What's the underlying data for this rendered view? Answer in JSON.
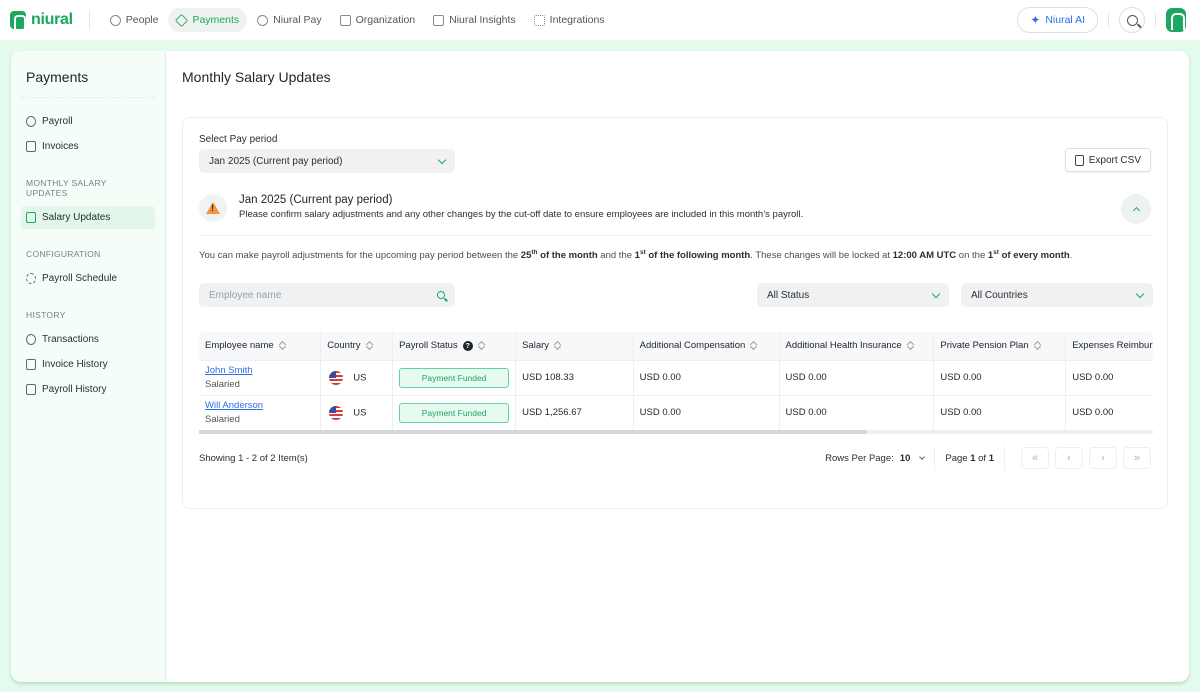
{
  "brand": {
    "name": "niural",
    "color": "#1ca860"
  },
  "nav": {
    "items": [
      {
        "label": "People",
        "icon": "people-icon",
        "active": false
      },
      {
        "label": "Payments",
        "icon": "payments-icon",
        "active": true
      },
      {
        "label": "Niural Pay",
        "icon": "shield-icon",
        "active": false
      },
      {
        "label": "Organization",
        "icon": "building-icon",
        "active": false
      },
      {
        "label": "Niural Insights",
        "icon": "chart-icon",
        "active": false
      },
      {
        "label": "Integrations",
        "icon": "grid-icon",
        "active": false
      }
    ],
    "ai_button": "Niural AI"
  },
  "sidebar": {
    "title": "Payments",
    "groups": [
      {
        "heading": "",
        "items": [
          {
            "label": "Payroll",
            "icon": "money-bag-icon"
          },
          {
            "label": "Invoices",
            "icon": "invoice-icon"
          }
        ]
      },
      {
        "heading": "MONTHLY SALARY UPDATES",
        "items": [
          {
            "label": "Salary Updates",
            "icon": "salary-list-icon",
            "active": true
          }
        ]
      },
      {
        "heading": "CONFIGURATION",
        "items": [
          {
            "label": "Payroll Schedule",
            "icon": "gear-icon"
          }
        ]
      },
      {
        "heading": "HISTORY",
        "items": [
          {
            "label": "Transactions",
            "icon": "dollar-circle-icon"
          },
          {
            "label": "Invoice History",
            "icon": "invoice-icon"
          },
          {
            "label": "Payroll History",
            "icon": "calendar-icon"
          }
        ]
      }
    ]
  },
  "main": {
    "title": "Monthly Salary Updates",
    "pay_period_label": "Select Pay period",
    "pay_period_value": "Jan 2025 (Current pay period)",
    "export_label": "Export CSV",
    "alert": {
      "title": "Jan 2025 (Current pay period)",
      "text": "Please confirm salary adjustments and any other changes by the cut-off date to ensure employees are included in this month’s payroll.",
      "color": "#f3953a"
    },
    "info": {
      "p1": "You can make payroll adjustments for the upcoming pay period between the ",
      "d1": "25",
      "s1": "th",
      "p2": " of the month",
      "p3": " and the ",
      "d2": "1",
      "s2": "st",
      "p4": " of the following month",
      "p5": ". These changes will be locked at ",
      "time": "12:00 AM UTC",
      "p6": " on the ",
      "d3": "1",
      "s3": "st",
      "p7": " of every month",
      "p8": "."
    },
    "search_placeholder": "Employee name",
    "status_filter": "All Status",
    "country_filter": "All Countries"
  },
  "table": {
    "columns": [
      "Employee name",
      "Country",
      "Payroll Status",
      "Salary",
      "Additional Compensation",
      "Additional Health Insurance",
      "Private Pension Plan",
      "Expenses Reimbursement"
    ],
    "rows": [
      {
        "name": "John Smith",
        "type": "Salaried",
        "country": "US",
        "status": "Payment Funded",
        "salary": "USD 108.33",
        "add_comp": "USD 0.00",
        "health": "USD 0.00",
        "pension": "USD 0.00",
        "expenses": "USD 0.00"
      },
      {
        "name": "Will Anderson",
        "type": "Salaried",
        "country": "US",
        "status": "Payment Funded",
        "salary": "USD 1,256.67",
        "add_comp": "USD 0.00",
        "health": "USD 0.00",
        "pension": "USD 0.00",
        "expenses": "USD 0.00"
      }
    ],
    "scroll_fraction": 0.7
  },
  "footer": {
    "showing": "Showing 1 - 2 of 2 Item(s)",
    "rows_label": "Rows Per Page:",
    "rows_value": "10",
    "page_label": "Page",
    "page_current": "1",
    "page_of": "of",
    "page_total": "1",
    "buttons": [
      "«",
      "‹",
      "›",
      "»"
    ]
  }
}
